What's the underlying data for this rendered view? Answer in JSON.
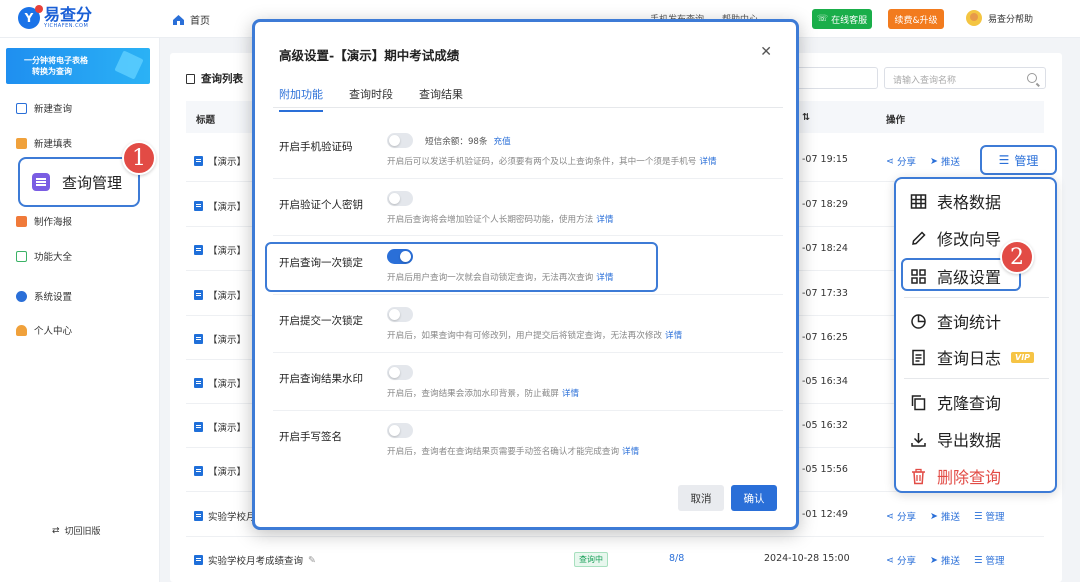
{
  "app": {
    "logo_text": "易查分",
    "logo_sub": "YICHAFEN.COM",
    "home": "首页",
    "top_links": [
      "手机发布查询",
      "帮助中心"
    ],
    "service_btn": "在线客服",
    "upgrade_btn": "续费&升级",
    "user_name": "易查分帮助"
  },
  "sidebar": {
    "banner_line1": "一分钟将电子表格",
    "banner_line2": "转换为查询",
    "items": [
      {
        "label": "新建查询",
        "icon": "search-doc-icon"
      },
      {
        "label": "新建填表",
        "icon": "form-icon"
      },
      {
        "label": "查询管理",
        "icon": "list-icon"
      },
      {
        "label": "制作海报",
        "icon": "poster-icon"
      },
      {
        "label": "功能大全",
        "icon": "grid-icon"
      },
      {
        "label": "系统设置",
        "icon": "gear-icon"
      },
      {
        "label": "个人中心",
        "icon": "user-icon"
      }
    ],
    "footer": "切回旧版"
  },
  "list": {
    "title": "查询列表",
    "search_placeholder": "请输入查询名称",
    "col_title": "标题",
    "col_ops": "操作",
    "rows": [
      {
        "title": "【演示】",
        "date": "-07 19:15"
      },
      {
        "title": "【演示】",
        "date": "-07 18:29"
      },
      {
        "title": "【演示】",
        "date": "-07 18:24"
      },
      {
        "title": "【演示】",
        "date": "-07 17:33"
      },
      {
        "title": "【演示】",
        "date": "-07 16:25"
      },
      {
        "title": "【演示】",
        "date": "-05 16:34"
      },
      {
        "title": "【演示】",
        "date": "-05 16:32"
      },
      {
        "title": "【演示】",
        "date": "-05 15:56"
      },
      {
        "title": "实验学校月",
        "date": "-01 12:49"
      },
      {
        "title": "实验学校月考成绩查询",
        "date": "2024-10-28 15:00",
        "status": "查询中",
        "count": "8/8"
      }
    ],
    "op_share": "分享",
    "op_push": "推送",
    "op_manage": "管理"
  },
  "manage_button": "管理",
  "dropdown": {
    "items": [
      {
        "label": "表格数据",
        "icon": "table-icon"
      },
      {
        "label": "修改向导",
        "icon": "pencil-icon"
      },
      {
        "label": "高级设置",
        "icon": "grid-icon"
      },
      {
        "label": "查询统计",
        "icon": "pie-icon"
      },
      {
        "label": "查询日志",
        "icon": "log-icon",
        "badge": "VIP"
      },
      {
        "label": "克隆查询",
        "icon": "copy-icon"
      },
      {
        "label": "导出数据",
        "icon": "download-icon"
      },
      {
        "label": "删除查询",
        "icon": "trash-icon",
        "danger": true
      }
    ]
  },
  "callouts": [
    "1",
    "2"
  ],
  "highlight_label": "查询管理",
  "modal": {
    "title": "高级设置-【演示】期中考试成绩",
    "tabs": [
      "附加功能",
      "查询时段",
      "查询结果"
    ],
    "settings": [
      {
        "label": "开启手机验证码",
        "on": false,
        "sms": "短信余额：98条",
        "sms_link": "充值",
        "desc": "开启后可以发送手机验证码，必须要有两个及以上查询条件，其中一个须是手机号",
        "link": "详情"
      },
      {
        "label": "开启验证个人密钥",
        "on": false,
        "desc": "开启后查询将会增加验证个人长期密码功能，使用方法",
        "link": "详情"
      },
      {
        "label": "开启查询一次锁定",
        "on": true,
        "desc": "开启后用户查询一次就会自动锁定查询，无法再次查询",
        "link": "详情"
      },
      {
        "label": "开启提交一次锁定",
        "on": false,
        "desc": "开启后，如果查询中有可修改列，用户提交后将锁定查询，无法再次修改",
        "link": "详情"
      },
      {
        "label": "开启查询结果水印",
        "on": false,
        "desc": "开启后，查询结果会添加水印背景，防止截屏",
        "link": "详情"
      },
      {
        "label": "开启手写签名",
        "on": false,
        "desc": "开启后，查询者在查询结果页需要手动签名确认才能完成查询",
        "link": "详情"
      }
    ],
    "cancel": "取消",
    "confirm": "确认"
  },
  "colors": {
    "primary": "#2a6fd8",
    "highlight": "#3d7bd6",
    "callout": "#e24b45",
    "service": "#1aae4a",
    "upgrade": "#f27b1e"
  }
}
